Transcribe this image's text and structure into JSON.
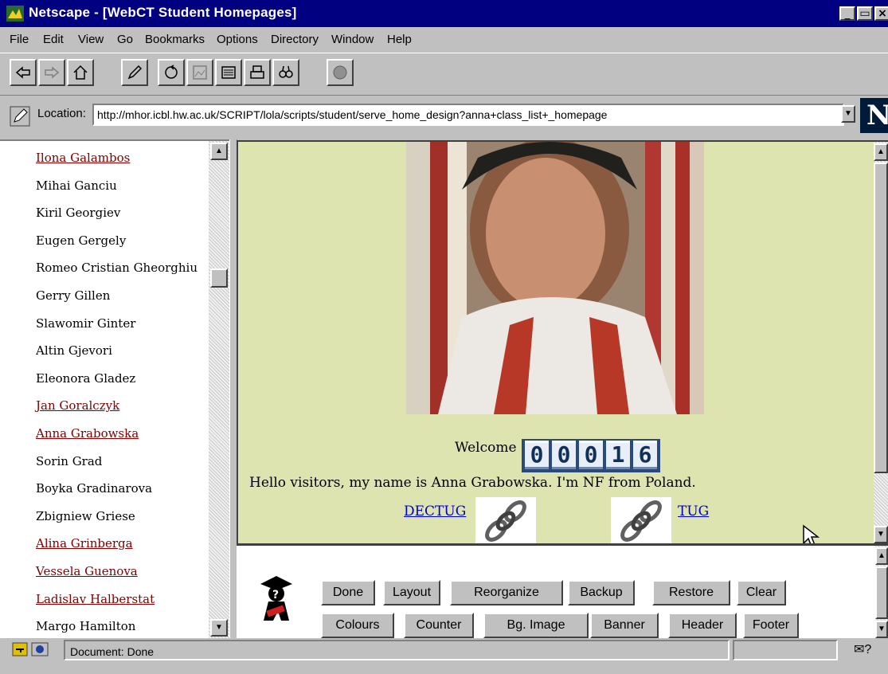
{
  "window": {
    "title": "Netscape - [WebCT Student Homepages]"
  },
  "menu": [
    "File",
    "Edit",
    "View",
    "Go",
    "Bookmarks",
    "Options",
    "Directory",
    "Window",
    "Help"
  ],
  "toolbar_icons": [
    "back-icon",
    "forward-icon",
    "home-icon",
    "edit-icon",
    "reload-icon",
    "images-icon",
    "open-icon",
    "print-icon",
    "find-icon",
    "stop-icon"
  ],
  "location": {
    "label": "Location:",
    "url": "http://mhor.icbl.hw.ac.uk/SCRIPT/lola/scripts/student/serve_home_design?anna+class_list+_homepage"
  },
  "logo_letter": "N",
  "students": [
    {
      "name": "Ilona Galambos",
      "link": true
    },
    {
      "name": "Mihai Ganciu",
      "link": false
    },
    {
      "name": "Kiril Georgiev",
      "link": false
    },
    {
      "name": "Eugen Gergely",
      "link": false
    },
    {
      "name": "Romeo Cristian Gheorghiu",
      "link": false
    },
    {
      "name": "Gerry Gillen",
      "link": false
    },
    {
      "name": "Slawomir Ginter",
      "link": false
    },
    {
      "name": "Altin Gjevori",
      "link": false
    },
    {
      "name": "Eleonora Gladez",
      "link": false
    },
    {
      "name": "Jan Goralczyk",
      "link": true
    },
    {
      "name": "Anna Grabowska",
      "link": true
    },
    {
      "name": "Sorin Grad",
      "link": false
    },
    {
      "name": "Boyka Gradinarova",
      "link": false
    },
    {
      "name": "Zbigniew Griese",
      "link": false
    },
    {
      "name": "Alina Grinberga",
      "link": true
    },
    {
      "name": "Vessela Guenova",
      "link": true
    },
    {
      "name": "Ladislav Halberstat",
      "link": true
    },
    {
      "name": "Margo Hamilton",
      "link": false
    }
  ],
  "homepage": {
    "welcome": "Welcome",
    "counter_digits": [
      "0",
      "0",
      "0",
      "1",
      "6"
    ],
    "hello": "Hello visitors, my name is Anna Grabowska. I'm NF from Poland.",
    "links": [
      "DECTUG",
      "TUG"
    ]
  },
  "design_buttons": {
    "row1": [
      "Done",
      "Layout",
      "Reorganize",
      "Backup",
      "Restore",
      "Clear"
    ],
    "row2": [
      "Colours",
      "Counter",
      "Bg. Image",
      "Banner",
      "Header",
      "Footer"
    ]
  },
  "status": {
    "text": "Document: Done"
  },
  "colors": {
    "titlebar": "#000080",
    "visited_link": "#800000",
    "link": "#0000d0",
    "page_bg": "#dde4b0"
  }
}
